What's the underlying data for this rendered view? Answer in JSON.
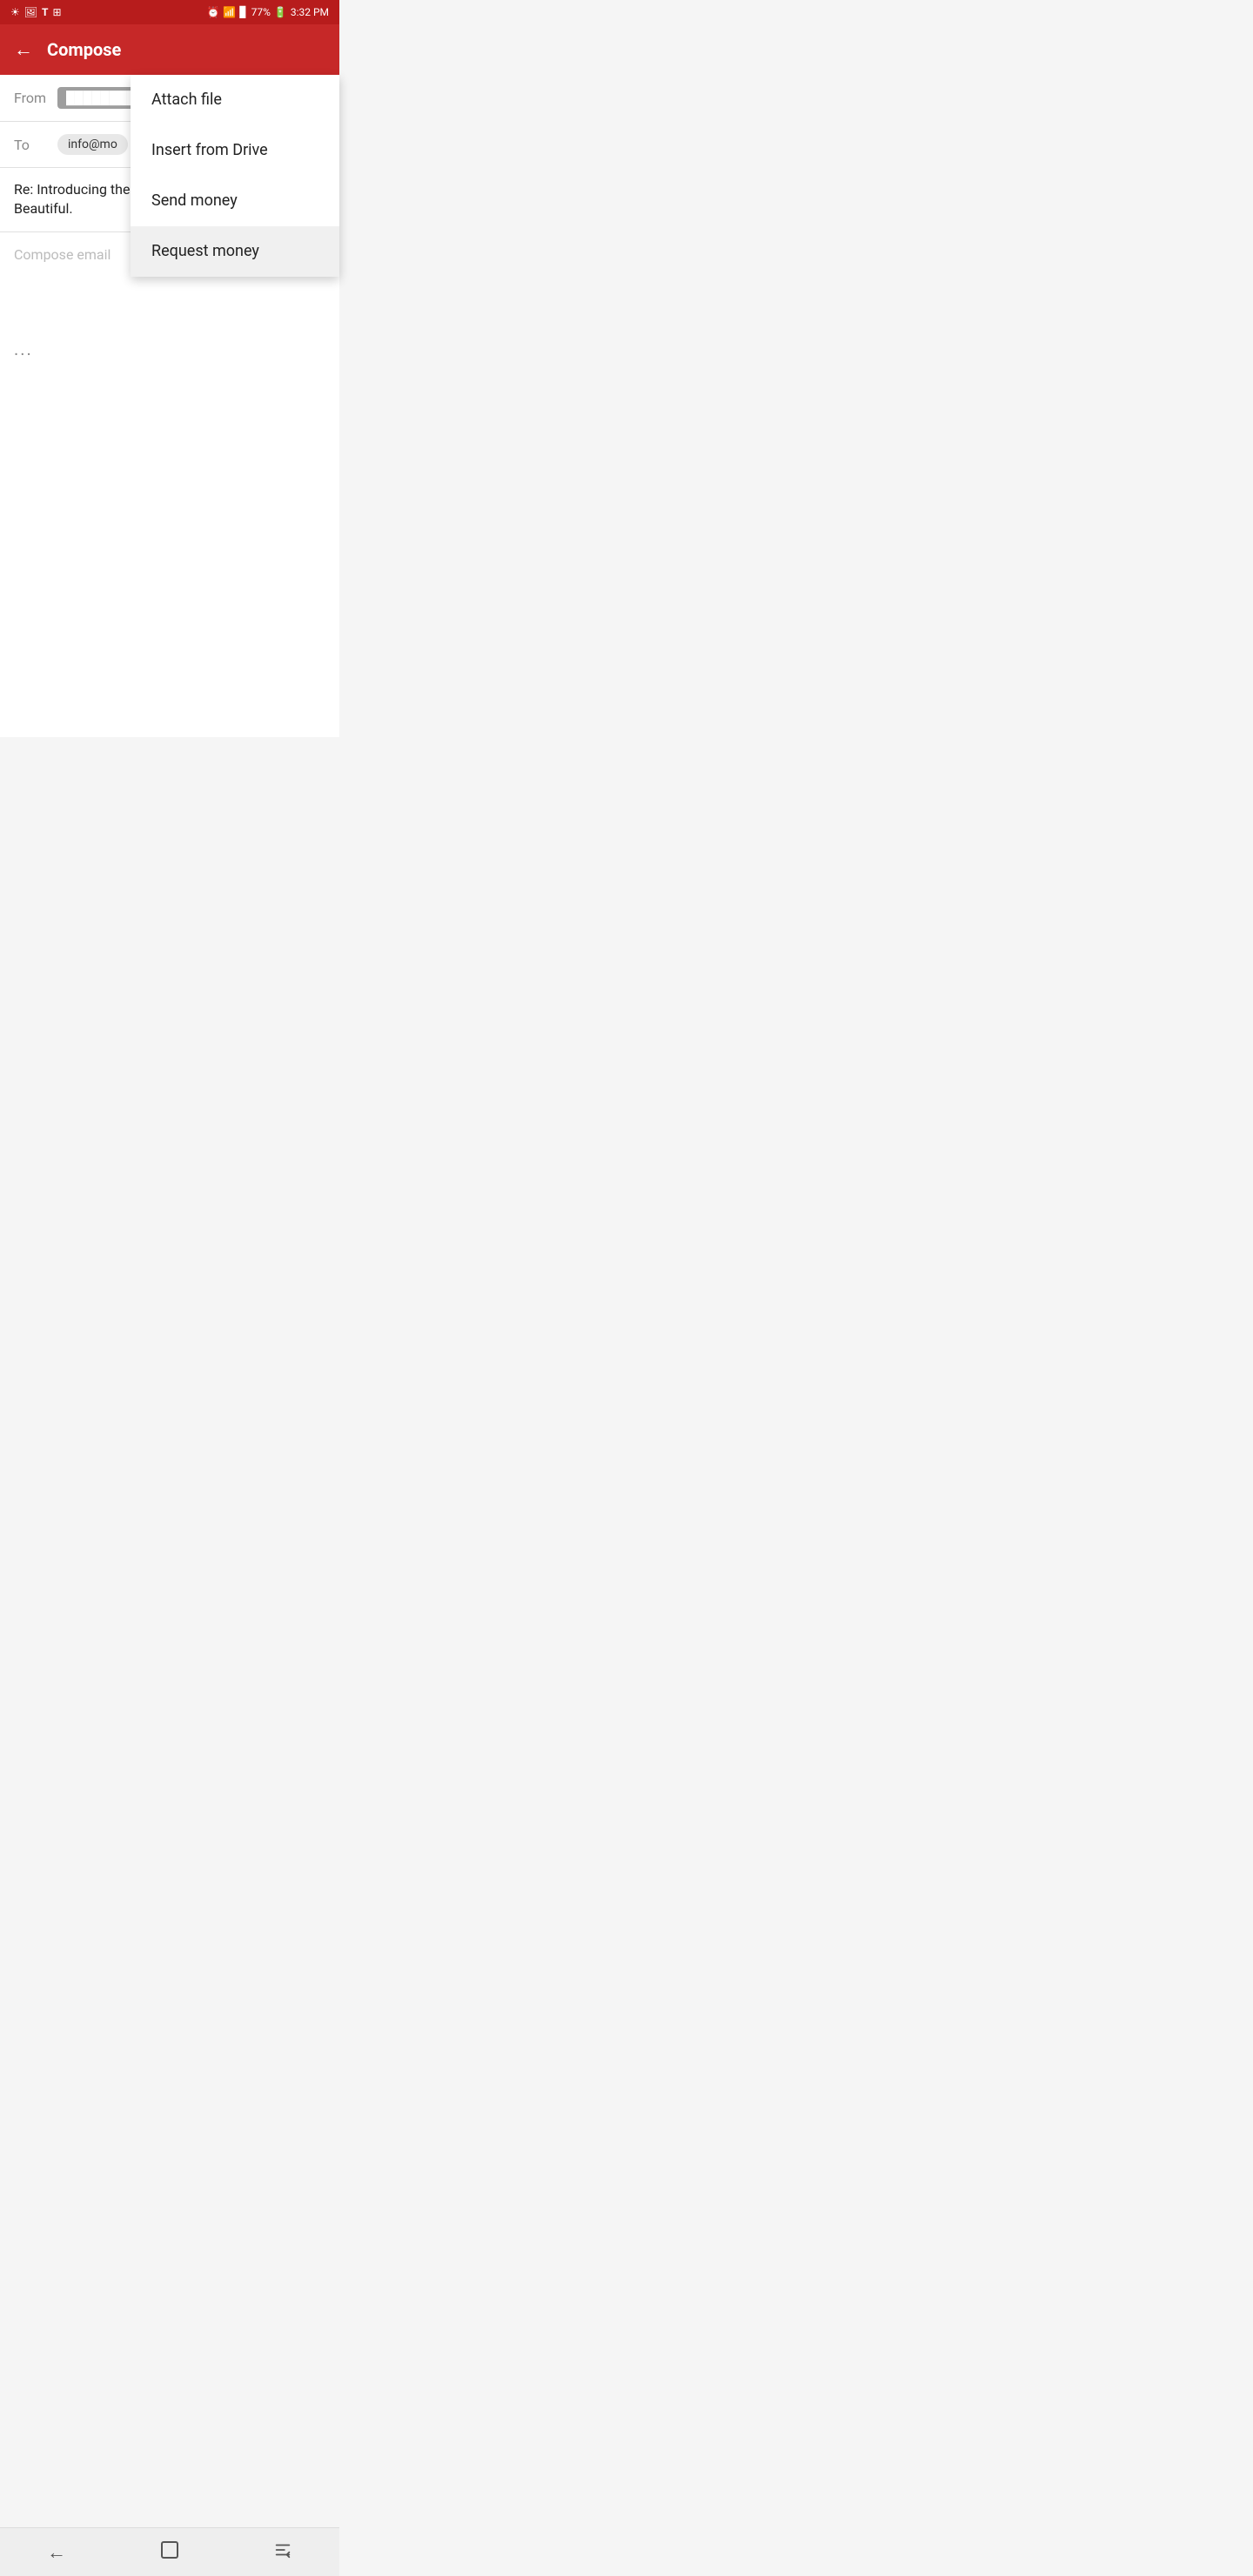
{
  "statusBar": {
    "time": "3:32 PM",
    "battery": "77%",
    "icons_left": [
      "brightness-icon",
      "image-icon",
      "t-mobile-icon",
      "telekom-icon"
    ],
    "icons_right": [
      "alarm-icon",
      "wifi-icon",
      "signal-icon",
      "battery-icon"
    ]
  },
  "appBar": {
    "title": "Compose",
    "back_label": "←"
  },
  "composeForm": {
    "from_label": "From",
    "from_value": "████████████",
    "to_label": "To",
    "to_value": "info@mo",
    "subject": "Re: Introducing the new moto x4. Tough. Smart. Beautiful.",
    "body_placeholder": "Compose email"
  },
  "dropdown": {
    "items": [
      {
        "id": "attach-file",
        "label": "Attach file"
      },
      {
        "id": "insert-drive",
        "label": "Insert from Drive"
      },
      {
        "id": "send-money",
        "label": "Send money"
      },
      {
        "id": "request-money",
        "label": "Request money"
      }
    ]
  },
  "navBar": {
    "back": "←",
    "recents": "▢",
    "menu": "⇥"
  }
}
